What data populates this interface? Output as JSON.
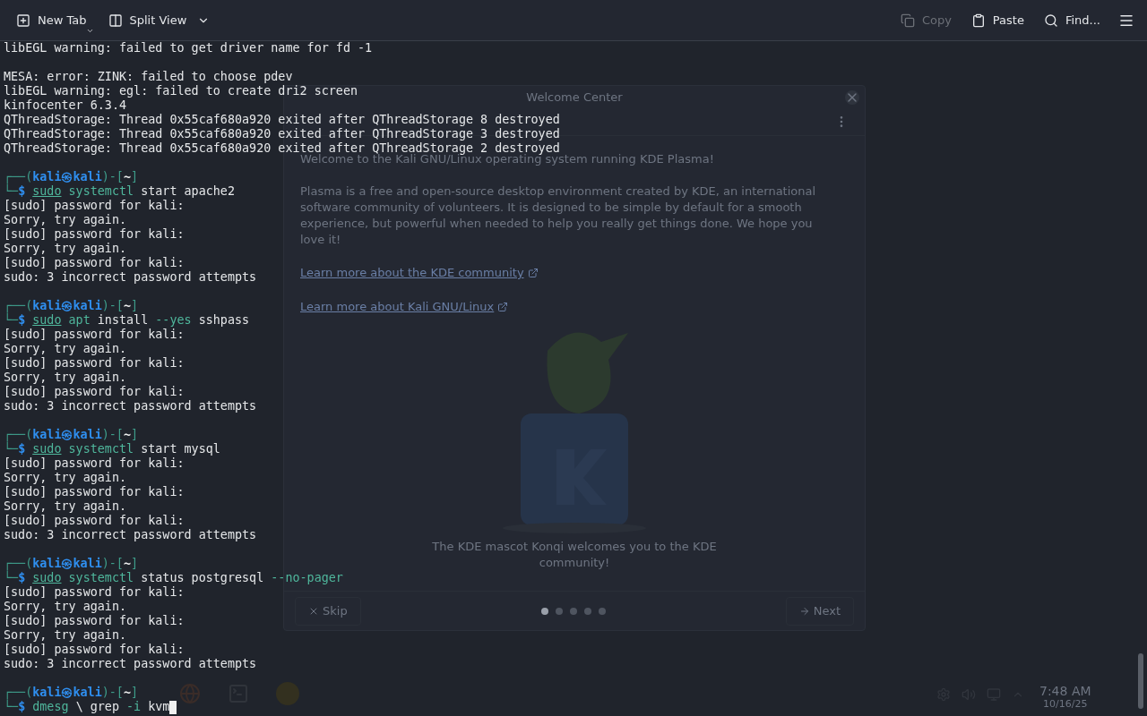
{
  "toolbar": {
    "left": [
      {
        "kind": "new_tab",
        "label": "New Tab"
      },
      {
        "kind": "split_view",
        "label": "Split View"
      }
    ],
    "right": [
      {
        "kind": "copy",
        "label": "Copy",
        "disabled": true
      },
      {
        "kind": "paste",
        "label": "Paste",
        "disabled": false
      },
      {
        "kind": "find",
        "label": "Find...",
        "disabled": false
      }
    ]
  },
  "terminal": {
    "lines": [
      {
        "kind": "text",
        "text": "libEGL warning: failed to get driver name for fd -1"
      },
      {
        "kind": "blank"
      },
      {
        "kind": "text",
        "text": "MESA: error: ZINK: failed to choose pdev"
      },
      {
        "kind": "text",
        "text": "libEGL warning: egl: failed to create dri2 screen"
      },
      {
        "kind": "text",
        "text": "kinfocenter 6.3.4"
      },
      {
        "kind": "text",
        "text": "QThreadStorage: Thread 0x55caf680a920 exited after QThreadStorage 8 destroyed"
      },
      {
        "kind": "text",
        "text": "QThreadStorage: Thread 0x55caf680a920 exited after QThreadStorage 3 destroyed"
      },
      {
        "kind": "text",
        "text": "QThreadStorage: Thread 0x55caf680a920 exited after QThreadStorage 2 destroyed"
      },
      {
        "kind": "blank"
      },
      {
        "kind": "prompt",
        "open": "┌──(",
        "userhost": "kali㉿kali",
        "mid": ")-[",
        "dir": "~",
        "close": "]",
        "mark": "└─",
        "dollar": "$",
        "cursor": false,
        "command": [
          {
            "kind": "sudo",
            "text": "sudo"
          },
          {
            "kind": "cmd",
            "text": "systemctl"
          },
          {
            "kind": "arg",
            "text": "start apache2"
          }
        ]
      },
      {
        "kind": "text",
        "text": "[sudo] password for kali:"
      },
      {
        "kind": "text",
        "text": "Sorry, try again."
      },
      {
        "kind": "text",
        "text": "[sudo] password for kali:"
      },
      {
        "kind": "text",
        "text": "Sorry, try again."
      },
      {
        "kind": "text",
        "text": "[sudo] password for kali:"
      },
      {
        "kind": "text",
        "text": "sudo: 3 incorrect password attempts"
      },
      {
        "kind": "blank"
      },
      {
        "kind": "prompt",
        "open": "┌──(",
        "userhost": "kali㉿kali",
        "mid": ")-[",
        "dir": "~",
        "close": "]",
        "mark": "└─",
        "dollar": "$",
        "cursor": false,
        "command": [
          {
            "kind": "sudo",
            "text": "sudo"
          },
          {
            "kind": "cmd",
            "text": "apt"
          },
          {
            "kind": "arg",
            "text": "install"
          },
          {
            "kind": "opt",
            "text": "--yes"
          },
          {
            "kind": "arg",
            "text": "sshpass"
          }
        ]
      },
      {
        "kind": "text",
        "text": "[sudo] password for kali:"
      },
      {
        "kind": "text",
        "text": "Sorry, try again."
      },
      {
        "kind": "text",
        "text": "[sudo] password for kali:"
      },
      {
        "kind": "text",
        "text": "Sorry, try again."
      },
      {
        "kind": "text",
        "text": "[sudo] password for kali:"
      },
      {
        "kind": "text",
        "text": "sudo: 3 incorrect password attempts"
      },
      {
        "kind": "blank"
      },
      {
        "kind": "prompt",
        "open": "┌──(",
        "userhost": "kali㉿kali",
        "mid": ")-[",
        "dir": "~",
        "close": "]",
        "mark": "└─",
        "dollar": "$",
        "cursor": false,
        "command": [
          {
            "kind": "sudo",
            "text": "sudo"
          },
          {
            "kind": "cmd",
            "text": "systemctl"
          },
          {
            "kind": "arg",
            "text": "start mysql"
          }
        ]
      },
      {
        "kind": "text",
        "text": "[sudo] password for kali:"
      },
      {
        "kind": "text",
        "text": "Sorry, try again."
      },
      {
        "kind": "text",
        "text": "[sudo] password for kali:"
      },
      {
        "kind": "text",
        "text": "Sorry, try again."
      },
      {
        "kind": "text",
        "text": "[sudo] password for kali:"
      },
      {
        "kind": "text",
        "text": "sudo: 3 incorrect password attempts"
      },
      {
        "kind": "blank"
      },
      {
        "kind": "prompt",
        "open": "┌──(",
        "userhost": "kali㉿kali",
        "mid": ")-[",
        "dir": "~",
        "close": "]",
        "mark": "└─",
        "dollar": "$",
        "cursor": false,
        "command": [
          {
            "kind": "sudo",
            "text": "sudo"
          },
          {
            "kind": "cmd",
            "text": "systemctl"
          },
          {
            "kind": "arg",
            "text": "status postgresql"
          },
          {
            "kind": "opt",
            "text": "--no-pager"
          }
        ]
      },
      {
        "kind": "text",
        "text": "[sudo] password for kali:"
      },
      {
        "kind": "text",
        "text": "Sorry, try again."
      },
      {
        "kind": "text",
        "text": "[sudo] password for kali:"
      },
      {
        "kind": "text",
        "text": "Sorry, try again."
      },
      {
        "kind": "text",
        "text": "[sudo] password for kali:"
      },
      {
        "kind": "text",
        "text": "sudo: 3 incorrect password attempts"
      },
      {
        "kind": "blank"
      },
      {
        "kind": "prompt",
        "open": "┌──(",
        "userhost": "kali㉿kali",
        "mid": ")-[",
        "dir": "~",
        "close": "]",
        "mark": "└─",
        "dollar": "$",
        "cursor": true,
        "command": [
          {
            "kind": "cmd",
            "text": "dmesg"
          },
          {
            "kind": "arg",
            "text": "\\ grep"
          },
          {
            "kind": "opt",
            "text": "-i"
          },
          {
            "kind": "arg",
            "text": "kvm"
          }
        ]
      }
    ]
  },
  "welcome_window": {
    "title": "Welcome Center",
    "intro": "Welcome to the Kali GNU/Linux operating system running KDE Plasma!",
    "paragraph": "Plasma is a free and open-source desktop environment created by KDE, an international software community of volunteers. It is designed to be simple by default for a smooth experience, but powerful when needed to help you really get things done. We hope you love it!",
    "links": [
      "Learn more about the KDE community",
      "Learn more about Kali GNU/Linux"
    ],
    "caption": "The KDE mascot Konqi welcomes you to the KDE community!",
    "pages": [
      {
        "selected": true
      },
      {
        "selected": false
      },
      {
        "selected": false
      },
      {
        "selected": false
      },
      {
        "selected": false
      }
    ],
    "skip": "Skip",
    "next": "Next"
  },
  "clock": {
    "time": "7:48 AM",
    "date": "10/16/25"
  }
}
